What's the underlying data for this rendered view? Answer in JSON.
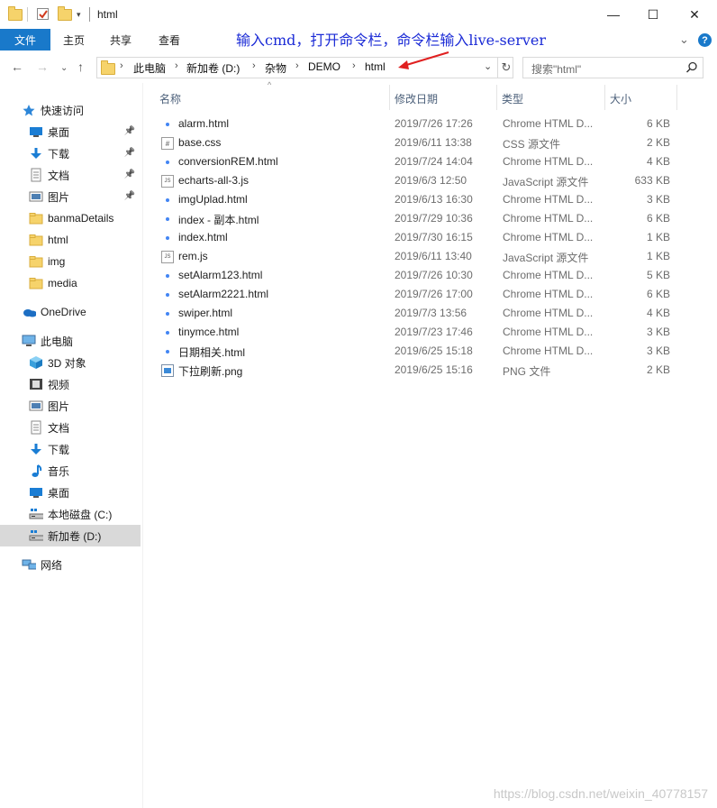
{
  "window": {
    "title": "html",
    "minimize": "—",
    "maximize": "☐",
    "close": "✕"
  },
  "ribbon": {
    "file_tab": "文件",
    "tabs": [
      "主页",
      "共享",
      "查看"
    ],
    "collapse": "⌄",
    "help": "?"
  },
  "annotation": "输入cmd，打开命令栏，命令栏输入live-server",
  "address": {
    "crumbs": [
      "此电脑",
      "新加卷 (D:)",
      "杂物",
      "DEMO",
      "html"
    ],
    "search_placeholder": "搜索\"html\""
  },
  "nav": [
    {
      "label": "快速访问",
      "icon": "star-icon"
    },
    {
      "label": "桌面",
      "icon": "desktop-icon",
      "pinned": true
    },
    {
      "label": "下载",
      "icon": "download-icon",
      "pinned": true
    },
    {
      "label": "文档",
      "icon": "document-icon",
      "pinned": true
    },
    {
      "label": "图片",
      "icon": "pictures-icon",
      "pinned": true
    },
    {
      "label": "banmaDetails",
      "icon": "folder-icon"
    },
    {
      "label": "html",
      "icon": "folder-icon"
    },
    {
      "label": "img",
      "icon": "folder-icon"
    },
    {
      "label": "media",
      "icon": "folder-icon"
    },
    {
      "label": "OneDrive",
      "icon": "cloud-icon"
    },
    {
      "label": "此电脑",
      "icon": "computer-icon"
    },
    {
      "label": "3D 对象",
      "icon": "cube-icon"
    },
    {
      "label": "视频",
      "icon": "video-icon"
    },
    {
      "label": "图片",
      "icon": "pictures-icon"
    },
    {
      "label": "文档",
      "icon": "document-icon"
    },
    {
      "label": "下载",
      "icon": "download-icon"
    },
    {
      "label": "音乐",
      "icon": "music-icon"
    },
    {
      "label": "桌面",
      "icon": "desktop-icon"
    },
    {
      "label": "本地磁盘 (C:)",
      "icon": "drive-icon"
    },
    {
      "label": "新加卷 (D:)",
      "icon": "drive-icon",
      "selected": true
    },
    {
      "label": "网络",
      "icon": "network-icon"
    }
  ],
  "columns": {
    "name": "名称",
    "date": "修改日期",
    "type": "类型",
    "size": "大小"
  },
  "files": [
    {
      "name": "alarm.html",
      "date": "2019/7/26 17:26",
      "type": "Chrome HTML D...",
      "size": "6 KB",
      "icon": "chrome"
    },
    {
      "name": "base.css",
      "date": "2019/6/11 13:38",
      "type": "CSS 源文件",
      "size": "2 KB",
      "icon": "css"
    },
    {
      "name": "conversionREM.html",
      "date": "2019/7/24 14:04",
      "type": "Chrome HTML D...",
      "size": "4 KB",
      "icon": "chrome"
    },
    {
      "name": "echarts-all-3.js",
      "date": "2019/6/3 12:50",
      "type": "JavaScript 源文件",
      "size": "633 KB",
      "icon": "js"
    },
    {
      "name": "imgUplad.html",
      "date": "2019/6/13 16:30",
      "type": "Chrome HTML D...",
      "size": "3 KB",
      "icon": "chrome"
    },
    {
      "name": "index - 副本.html",
      "date": "2019/7/29 10:36",
      "type": "Chrome HTML D...",
      "size": "6 KB",
      "icon": "chrome"
    },
    {
      "name": "index.html",
      "date": "2019/7/30 16:15",
      "type": "Chrome HTML D...",
      "size": "1 KB",
      "icon": "chrome"
    },
    {
      "name": "rem.js",
      "date": "2019/6/11 13:40",
      "type": "JavaScript 源文件",
      "size": "1 KB",
      "icon": "js"
    },
    {
      "name": "setAlarm123.html",
      "date": "2019/7/26 10:30",
      "type": "Chrome HTML D...",
      "size": "5 KB",
      "icon": "chrome"
    },
    {
      "name": "setAlarm2221.html",
      "date": "2019/7/26 17:00",
      "type": "Chrome HTML D...",
      "size": "6 KB",
      "icon": "chrome"
    },
    {
      "name": "swiper.html",
      "date": "2019/7/3 13:56",
      "type": "Chrome HTML D...",
      "size": "4 KB",
      "icon": "chrome"
    },
    {
      "name": "tinymce.html",
      "date": "2019/7/23 17:46",
      "type": "Chrome HTML D...",
      "size": "3 KB",
      "icon": "chrome"
    },
    {
      "name": "日期相关.html",
      "date": "2019/6/25 15:18",
      "type": "Chrome HTML D...",
      "size": "3 KB",
      "icon": "chrome"
    },
    {
      "name": "下拉刷新.png",
      "date": "2019/6/25 15:16",
      "type": "PNG 文件",
      "size": "2 KB",
      "icon": "png"
    }
  ],
  "watermark": "https://blog.csdn.net/weixin_40778157"
}
